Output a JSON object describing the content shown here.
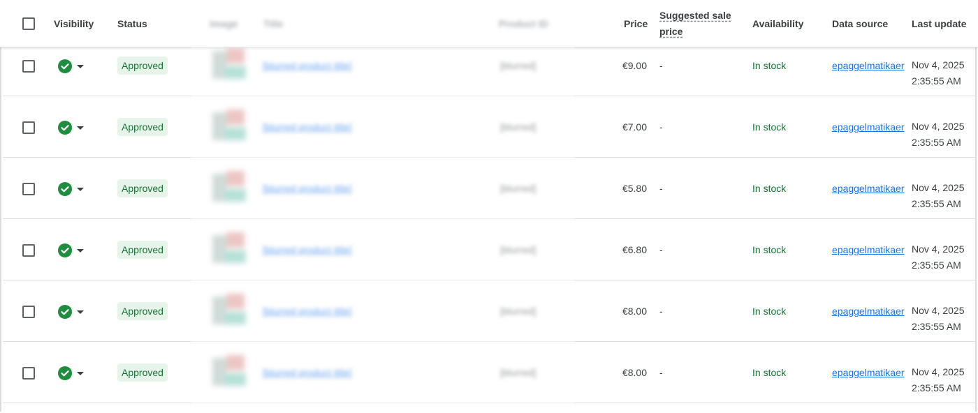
{
  "header": {
    "visibility": "Visibility",
    "status": "Status",
    "image": "Image",
    "title": "Title",
    "product_id": "Product ID",
    "price": "Price",
    "suggested_sale_price_line1": "Suggested sale",
    "suggested_sale_price_line2": "price",
    "availability": "Availability",
    "data_source": "Data source",
    "last_update": "Last update"
  },
  "colors": {
    "approved_bg": "#e6f4ea",
    "approved_text": "#137333",
    "visibility_green": "#1e8e3e",
    "link_blue": "#1a73e8"
  },
  "rows": [
    {
      "visibility_icon": "check-circle-icon",
      "status": "Approved",
      "title": "[blurred product title]",
      "product_id": "[blurred]",
      "price": "€9.00",
      "suggested_price": "-",
      "availability": "In stock",
      "data_source": "epaggelmatikaer",
      "date": "Nov 4, 2025",
      "time": "2:35:55 AM"
    },
    {
      "visibility_icon": "check-circle-icon",
      "status": "Approved",
      "title": "[blurred product title]",
      "product_id": "[blurred]",
      "price": "€7.00",
      "suggested_price": "-",
      "availability": "In stock",
      "data_source": "epaggelmatikaer",
      "date": "Nov 4, 2025",
      "time": "2:35:55 AM"
    },
    {
      "visibility_icon": "check-circle-icon",
      "status": "Approved",
      "title": "[blurred product title]",
      "product_id": "[blurred]",
      "price": "€5.80",
      "suggested_price": "-",
      "availability": "In stock",
      "data_source": "epaggelmatikaer",
      "date": "Nov 4, 2025",
      "time": "2:35:55 AM"
    },
    {
      "visibility_icon": "check-circle-icon",
      "status": "Approved",
      "title": "[blurred product title]",
      "product_id": "[blurred]",
      "price": "€6.80",
      "suggested_price": "-",
      "availability": "In stock",
      "data_source": "epaggelmatikaer",
      "date": "Nov 4, 2025",
      "time": "2:35:55 AM"
    },
    {
      "visibility_icon": "check-circle-icon",
      "status": "Approved",
      "title": "[blurred product title]",
      "product_id": "[blurred]",
      "price": "€8.00",
      "suggested_price": "-",
      "availability": "In stock",
      "data_source": "epaggelmatikaer",
      "date": "Nov 4, 2025",
      "time": "2:35:55 AM"
    },
    {
      "visibility_icon": "check-circle-icon",
      "status": "Approved",
      "title": "[blurred product title]",
      "product_id": "[blurred]",
      "price": "€8.00",
      "suggested_price": "-",
      "availability": "In stock",
      "data_source": "epaggelmatikaer",
      "date": "Nov 4, 2025",
      "time": "2:35:55 AM"
    }
  ]
}
